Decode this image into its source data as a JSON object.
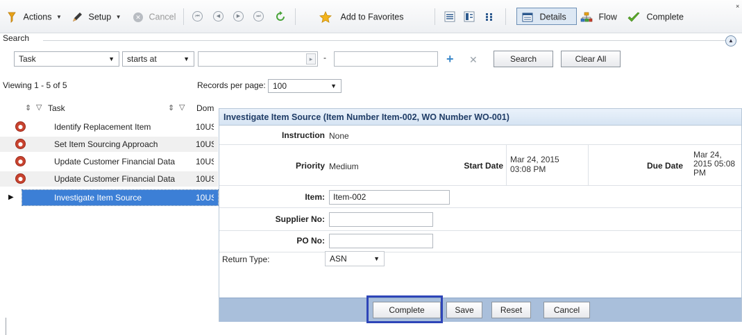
{
  "toolbar": {
    "actions_label": "Actions",
    "setup_label": "Setup",
    "cancel_label": "Cancel",
    "add_favorites_label": "Add to Favorites",
    "details_label": "Details",
    "flow_label": "Flow",
    "complete_label": "Complete"
  },
  "search": {
    "section_label": "Search",
    "field_value": "Task",
    "operator_value": "starts at",
    "from_value": "",
    "to_value": "",
    "separator": "-",
    "search_label": "Search",
    "clear_label": "Clear All"
  },
  "list": {
    "viewing": "Viewing 1 - 5 of 5",
    "records_per_page_label": "Records per page:",
    "records_per_page_value": "100",
    "columns": {
      "task": "Task",
      "domain": "Dom"
    },
    "rows": [
      {
        "task": "Identify Replacement Item",
        "domain": "10US"
      },
      {
        "task": "Set Item Sourcing Approach",
        "domain": "10US"
      },
      {
        "task": "Update Customer Financial Data",
        "domain": "10US"
      },
      {
        "task": "Update Customer Financial Data",
        "domain": "10US"
      },
      {
        "task": "Investigate Item Source",
        "domain": "10US"
      }
    ]
  },
  "form": {
    "title": "Investigate Item Source (Item Number Item-002, WO Number WO-001)",
    "instruction_label": "Instruction",
    "instruction_value": "None",
    "priority_label": "Priority",
    "priority_value": "Medium",
    "start_date_label": "Start Date",
    "start_date_value": "Mar 24, 2015 03:08 PM",
    "due_date_label": "Due Date",
    "due_date_value": "Mar 24, 2015 05:08 PM",
    "item_label": "Item:",
    "item_value": "Item-002",
    "supplier_label": "Supplier No:",
    "supplier_value": "",
    "po_label": "PO No:",
    "po_value": "",
    "return_type_label": "Return Type:",
    "return_type_value": "ASN",
    "complete_label": "Complete",
    "save_label": "Save",
    "reset_label": "Reset",
    "cancel_label": "Cancel"
  },
  "colors": {
    "selected_row": "#3c7fd6",
    "footer_bar": "#a9bfdb",
    "highlight": "#2e45b8"
  }
}
